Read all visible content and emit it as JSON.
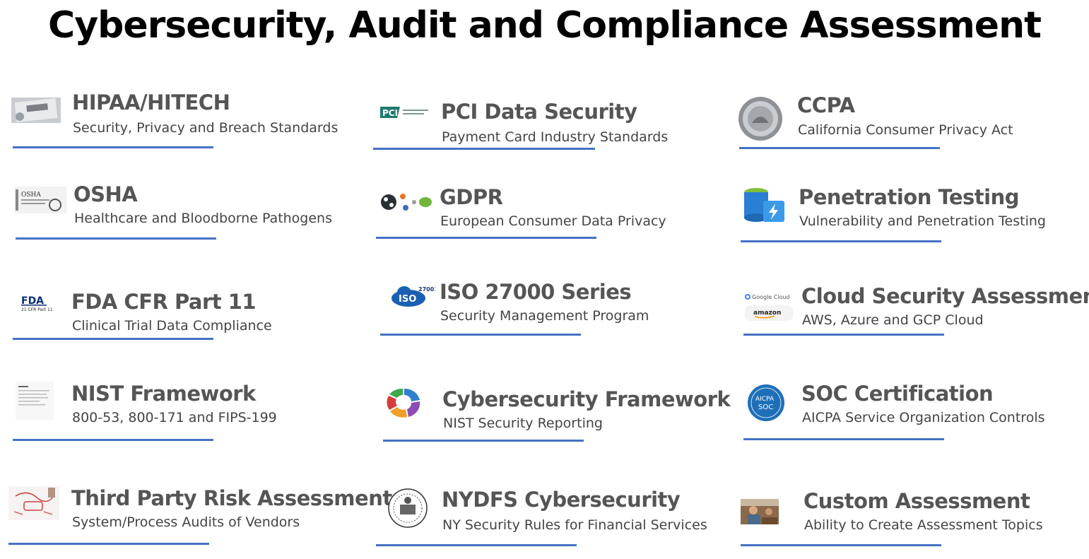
{
  "page": {
    "title": "Cybersecurity, Audit and Compliance Assessment",
    "accent_color": "#4472C4"
  },
  "items": [
    {
      "heading": "HIPAA/HITECH",
      "sub": "Security, Privacy and Breach Standards",
      "icon": "hipaa-document-icon"
    },
    {
      "heading": "PCI Data Security",
      "sub": "Payment Card Industry Standards",
      "icon": "pci-logo-icon"
    },
    {
      "heading": "CCPA",
      "sub": "California Consumer Privacy Act",
      "icon": "california-seal-icon"
    },
    {
      "heading": "OSHA",
      "sub": "Healthcare and Bloodborne Pathogens",
      "icon": "osha-document-icon"
    },
    {
      "heading": "GDPR",
      "sub": "European Consumer Data Privacy",
      "icon": "gdpr-network-icon"
    },
    {
      "heading": "Penetration Testing",
      "sub": "Vulnerability and Penetration Testing",
      "icon": "database-lightning-icon"
    },
    {
      "heading": "FDA CFR Part 11",
      "sub": "Clinical Trial Data Compliance",
      "icon": "fda-logo-icon"
    },
    {
      "heading": "ISO 27000 Series",
      "sub": "Security Management Program",
      "icon": "iso-cloud-icon"
    },
    {
      "heading": "Cloud Security Assessment",
      "sub": "AWS, Azure and GCP Cloud",
      "icon": "cloud-providers-icon"
    },
    {
      "heading": "NIST Framework",
      "sub": "800-53, 800-171 and FIPS-199",
      "icon": "nist-document-icon"
    },
    {
      "heading": "Cybersecurity Framework",
      "sub": "NIST Security Reporting",
      "icon": "framework-wheel-icon"
    },
    {
      "heading": "SOC Certification",
      "sub": "AICPA Service Organization Controls",
      "icon": "aicpa-soc-badge-icon"
    },
    {
      "heading": "Third Party Risk Assessment",
      "sub": "System/Process Audits of Vendors",
      "icon": "risk-sketch-icon"
    },
    {
      "heading": "NYDFS Cybersecurity",
      "sub": "NY Security Rules for Financial Services",
      "icon": "new-york-seal-icon"
    },
    {
      "heading": "Custom Assessment",
      "sub": "Ability to Create Assessment Topics",
      "icon": "workshop-photo-icon"
    }
  ],
  "logo_text": {
    "pci": "PCI",
    "fda": "FDA",
    "fda_sub": "21 CFR Part 11",
    "iso": "ISO",
    "iso_num": "27001",
    "google_cloud": "Google Cloud",
    "amazon": "amazon",
    "aicpa": "AICPA",
    "soc": "SOC"
  }
}
